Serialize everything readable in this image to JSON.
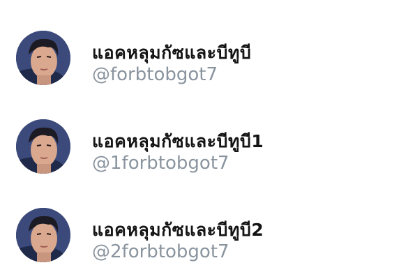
{
  "accounts": [
    {
      "display_name": "แอคหลุมกัซและบีทูบี",
      "handle": "@forbtobgot7",
      "avatar_icon": "profile-photo-avatar"
    },
    {
      "display_name": "แอคหลุมกัซและบีทูบี1",
      "handle": "@1forbtobgot7",
      "avatar_icon": "profile-photo-avatar"
    },
    {
      "display_name": "แอคหลุมกัซและบีทูบี2",
      "handle": "@2forbtobgot7",
      "avatar_icon": "profile-photo-avatar"
    }
  ],
  "colors": {
    "background": "#ffffff",
    "name_text": "#141414",
    "handle_text": "#8a949e"
  }
}
